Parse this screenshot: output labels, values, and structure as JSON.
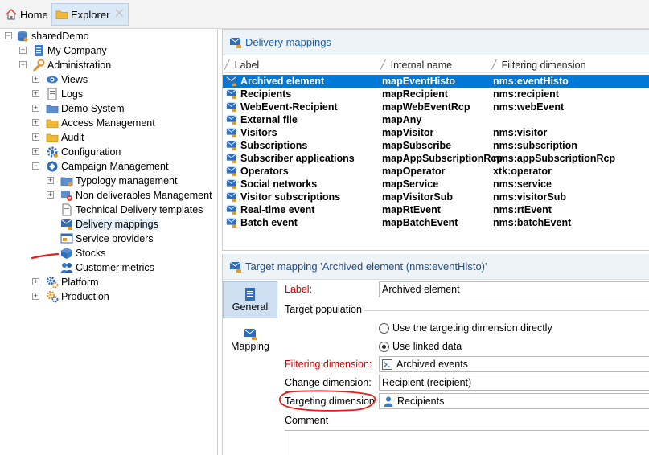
{
  "tabs": {
    "home_label": "Home",
    "explorer_label": "Explorer",
    "close_glyph": "✕"
  },
  "tree": {
    "root": "sharedDemo",
    "items": [
      {
        "label": "My Company",
        "icon": "company-icon"
      },
      {
        "label": "Administration",
        "icon": "wrench-icon"
      },
      {
        "label": "Views",
        "icon": "eye-icon"
      },
      {
        "label": "Logs",
        "icon": "logs-icon"
      },
      {
        "label": "Demo System",
        "icon": "folder-blue-icon"
      },
      {
        "label": "Access Management",
        "icon": "folder-yellow-icon"
      },
      {
        "label": "Audit",
        "icon": "folder-yellow-icon"
      },
      {
        "label": "Configuration",
        "icon": "gear-icon"
      },
      {
        "label": "Campaign Management",
        "icon": "campaign-icon"
      },
      {
        "label": "Typology management",
        "icon": "folder-blue-icon"
      },
      {
        "label": "Non deliverables Management",
        "icon": "non-deliverables-icon"
      },
      {
        "label": "Technical Delivery templates",
        "icon": "document-icon"
      },
      {
        "label": "Delivery mappings",
        "icon": "mapping-icon"
      },
      {
        "label": "Service providers",
        "icon": "service-icon"
      },
      {
        "label": "Stocks",
        "icon": "stocks-icon"
      },
      {
        "label": "Customer metrics",
        "icon": "metrics-icon"
      },
      {
        "label": "Platform",
        "icon": "platform-icon"
      },
      {
        "label": "Production",
        "icon": "production-icon"
      }
    ]
  },
  "list_panel": {
    "title": "Delivery mappings",
    "columns": [
      "Label",
      "Internal name",
      "Filtering dimension"
    ],
    "rows": [
      [
        "Archived element",
        "mapEventHisto",
        "nms:eventHisto"
      ],
      [
        "Recipients",
        "mapRecipient",
        "nms:recipient"
      ],
      [
        "WebEvent-Recipient",
        "mapWebEventRcp",
        "nms:webEvent"
      ],
      [
        "External file",
        "mapAny",
        ""
      ],
      [
        "Visitors",
        "mapVisitor",
        "nms:visitor"
      ],
      [
        "Subscriptions",
        "mapSubscribe",
        "nms:subscription"
      ],
      [
        "Subscriber applications",
        "mapAppSubscriptionRcp",
        "nms:appSubscriptionRcp"
      ],
      [
        "Operators",
        "mapOperator",
        "xtk:operator"
      ],
      [
        "Social networks",
        "mapService",
        "nms:service"
      ],
      [
        "Visitor subscriptions",
        "mapVisitorSub",
        "nms:visitorSub"
      ],
      [
        "Real-time event",
        "mapRtEvent",
        "nms:rtEvent"
      ],
      [
        "Batch event",
        "mapBatchEvent",
        "nms:batchEvent"
      ]
    ]
  },
  "detail_panel": {
    "title": "Target mapping 'Archived element (nms:eventHisto)'",
    "side_tabs": [
      "General",
      "Mapping"
    ],
    "label_caption": "Label:",
    "label_value": "Archived element",
    "target_population": "Target population",
    "radio_direct": "Use the targeting dimension directly",
    "radio_linked": "Use linked data",
    "filtering_caption": "Filtering dimension:",
    "filtering_value": "Archived events",
    "change_caption": "Change dimension:",
    "change_value": "Recipient (recipient)",
    "targeting_caption": "Targeting dimension:",
    "targeting_value": "Recipients",
    "comment_caption": "Comment"
  },
  "colors": {
    "selection": "#0078d7",
    "link_title": "#1f5fa8",
    "required": "#cc0000",
    "annotation": "#e0201a"
  }
}
